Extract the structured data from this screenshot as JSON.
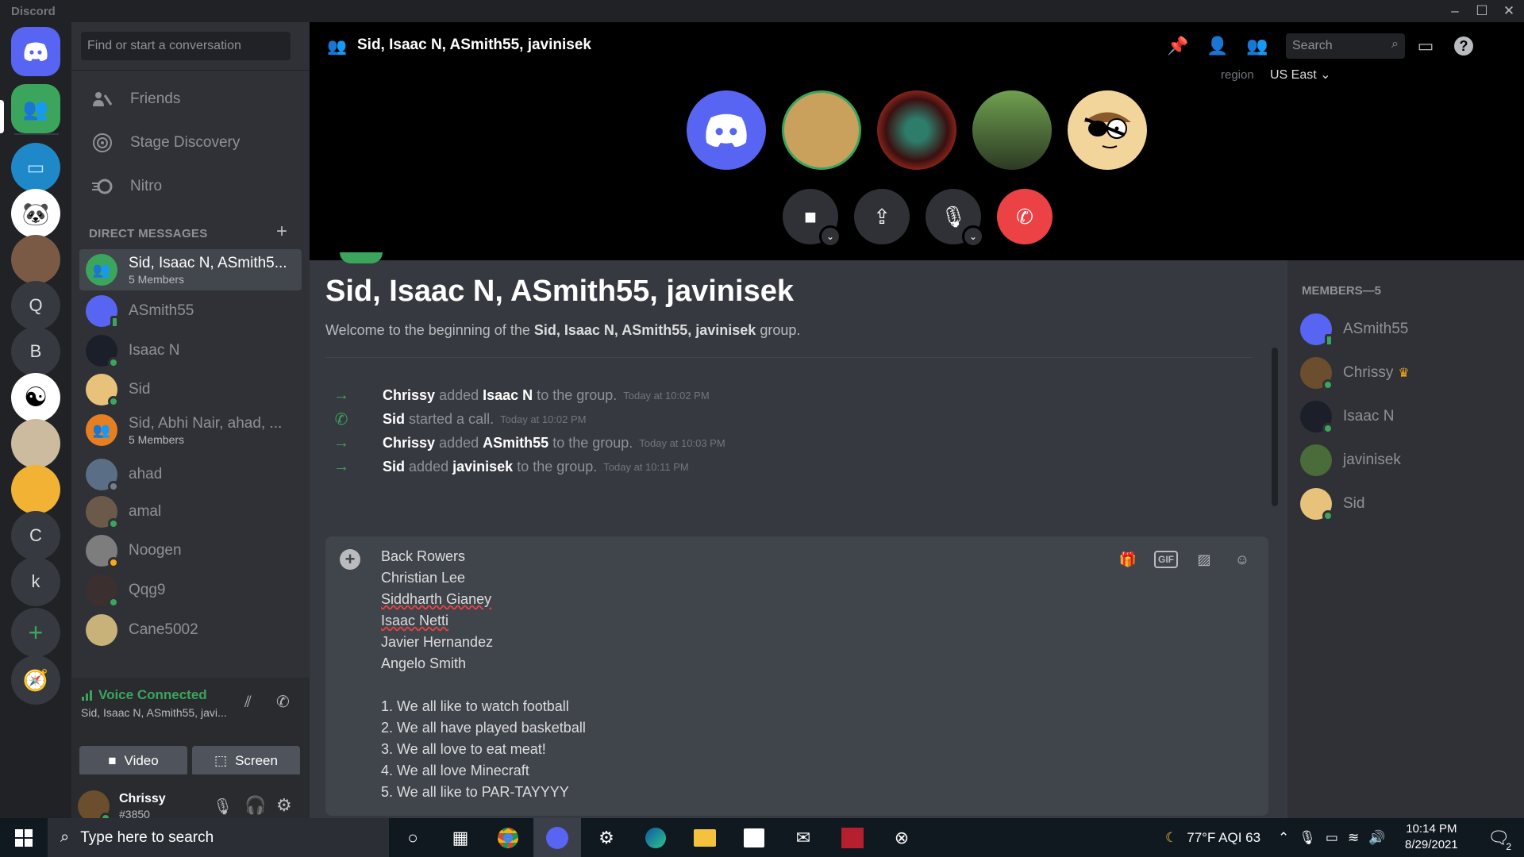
{
  "window": {
    "app_name": "Discord",
    "controls": [
      "–",
      "☐",
      "✕"
    ]
  },
  "guilds": [
    {
      "name": "home",
      "label": ""
    },
    {
      "name": "group-call",
      "label": ""
    },
    {
      "name": "server-monitor",
      "label": ""
    },
    {
      "name": "server-panda",
      "label": ""
    },
    {
      "name": "server-person",
      "label": ""
    },
    {
      "name": "server-q",
      "label": "Q"
    },
    {
      "name": "server-b",
      "label": "B"
    },
    {
      "name": "server-yinyang",
      "label": ""
    },
    {
      "name": "server-bowl",
      "label": ""
    },
    {
      "name": "server-yellow",
      "label": ""
    },
    {
      "name": "server-c",
      "label": "C"
    },
    {
      "name": "server-k",
      "label": "k"
    },
    {
      "name": "add-server",
      "label": "+"
    },
    {
      "name": "explore",
      "label": ""
    }
  ],
  "sidebar": {
    "search_placeholder": "Find or start a conversation",
    "nav": [
      {
        "label": "Friends"
      },
      {
        "label": "Stage Discovery"
      },
      {
        "label": "Nitro"
      }
    ],
    "dm_header": "DIRECT MESSAGES",
    "dms": [
      {
        "name": "Sid, Isaac N, ASmith5...",
        "sub": "5 Members",
        "active": true,
        "color": "#3ba55d",
        "status": "none"
      },
      {
        "name": "ASmith55",
        "sub": "",
        "color": "#5865f2",
        "status": "mobile"
      },
      {
        "name": "Isaac N",
        "sub": "",
        "color": "#1b1f2a",
        "status": "online"
      },
      {
        "name": "Sid",
        "sub": "",
        "color": "#e8c27a",
        "status": "online"
      },
      {
        "name": "Sid, Abhi Nair, ahad, ...",
        "sub": "5 Members",
        "color": "#e67e22",
        "status": "none"
      },
      {
        "name": "ahad",
        "sub": "",
        "color": "#5a6e86",
        "status": "offline"
      },
      {
        "name": "amal",
        "sub": "",
        "color": "#6b5a4a",
        "status": "online"
      },
      {
        "name": "Noogen",
        "sub": "",
        "color": "#7d7d7d",
        "status": "idle"
      },
      {
        "name": "Qqg9",
        "sub": "",
        "color": "#3b2f2f",
        "status": "online"
      },
      {
        "name": "Cane5002",
        "sub": "",
        "color": "#c9b27a",
        "status": "none"
      }
    ],
    "voice": {
      "status": "Voice Connected",
      "channel": "Sid, Isaac N, ASmith55, javi...",
      "video_label": "Video",
      "screen_label": "Screen"
    },
    "user": {
      "name": "Chrissy",
      "tag": "#3850"
    }
  },
  "header": {
    "title": "Sid, Isaac N, ASmith55, javinisek",
    "search_placeholder": "Search",
    "region_label": "region",
    "region_value": "US East"
  },
  "call": {
    "participants": [
      "discord-logo",
      "chrissy",
      "isaac-n",
      "javinisek",
      "sid"
    ]
  },
  "chat": {
    "group_title": "Sid, Isaac N, ASmith55, javinisek",
    "welcome_prefix": "Welcome to the beginning of the ",
    "welcome_group": "Sid, Isaac N, ASmith55, javinisek",
    "welcome_suffix": " group.",
    "system_messages": [
      {
        "icon": "arrow",
        "actor": "Chrissy",
        "verb": "added",
        "target": "Isaac N",
        "rest": "to the group.",
        "time": "Today at 10:02 PM"
      },
      {
        "icon": "phone",
        "actor": "Sid",
        "verb": "started a call.",
        "target": "",
        "rest": "",
        "time": "Today at 10:02 PM"
      },
      {
        "icon": "arrow",
        "actor": "Chrissy",
        "verb": "added",
        "target": "ASmith55",
        "rest": "to the group.",
        "time": "Today at 10:03 PM"
      },
      {
        "icon": "arrow",
        "actor": "Sid",
        "verb": "added",
        "target": "javinisek",
        "rest": "to the group.",
        "time": "Today at 10:11 PM"
      }
    ],
    "composer_lines": [
      {
        "text": "Back Rowers",
        "spell": false
      },
      {
        "text": "Christian Lee",
        "spell": false
      },
      {
        "text": "Siddharth Gianey",
        "spell": true
      },
      {
        "text": "Isaac Netti",
        "spell": true
      },
      {
        "text": "Javier Hernandez",
        "spell": false
      },
      {
        "text": "Angelo Smith",
        "spell": false
      },
      {
        "text": "",
        "spell": false
      },
      {
        "text": "1. We all like to watch football",
        "spell": false
      },
      {
        "text": "2. We all have played basketball",
        "spell": false
      },
      {
        "text": "3. We all love to eat meat!",
        "spell": false
      },
      {
        "text": "4. We all love Minecraft",
        "spell": false
      },
      {
        "text": "5. We all like to PAR-TAYYYY",
        "spell": false
      }
    ],
    "gif_label": "GIF"
  },
  "members": {
    "header": "MEMBERS—5",
    "list": [
      {
        "name": "ASmith55",
        "color": "#5865f2",
        "status": "mobile",
        "owner": false
      },
      {
        "name": "Chrissy",
        "color": "#6b4e2e",
        "status": "online",
        "owner": true
      },
      {
        "name": "Isaac N",
        "color": "#1b1f2a",
        "status": "online",
        "owner": false
      },
      {
        "name": "javinisek",
        "color": "#4a6b3a",
        "status": "none",
        "owner": false
      },
      {
        "name": "Sid",
        "color": "#e8c27a",
        "status": "online",
        "owner": false
      }
    ]
  },
  "taskbar": {
    "search_placeholder": "Type here to search",
    "weather": "77°F  AQI 63",
    "time": "10:14 PM",
    "date": "8/29/2021",
    "notif_count": "2"
  },
  "colors": {
    "accent": "#5865f2",
    "green": "#3ba55d",
    "red": "#ed4245"
  }
}
